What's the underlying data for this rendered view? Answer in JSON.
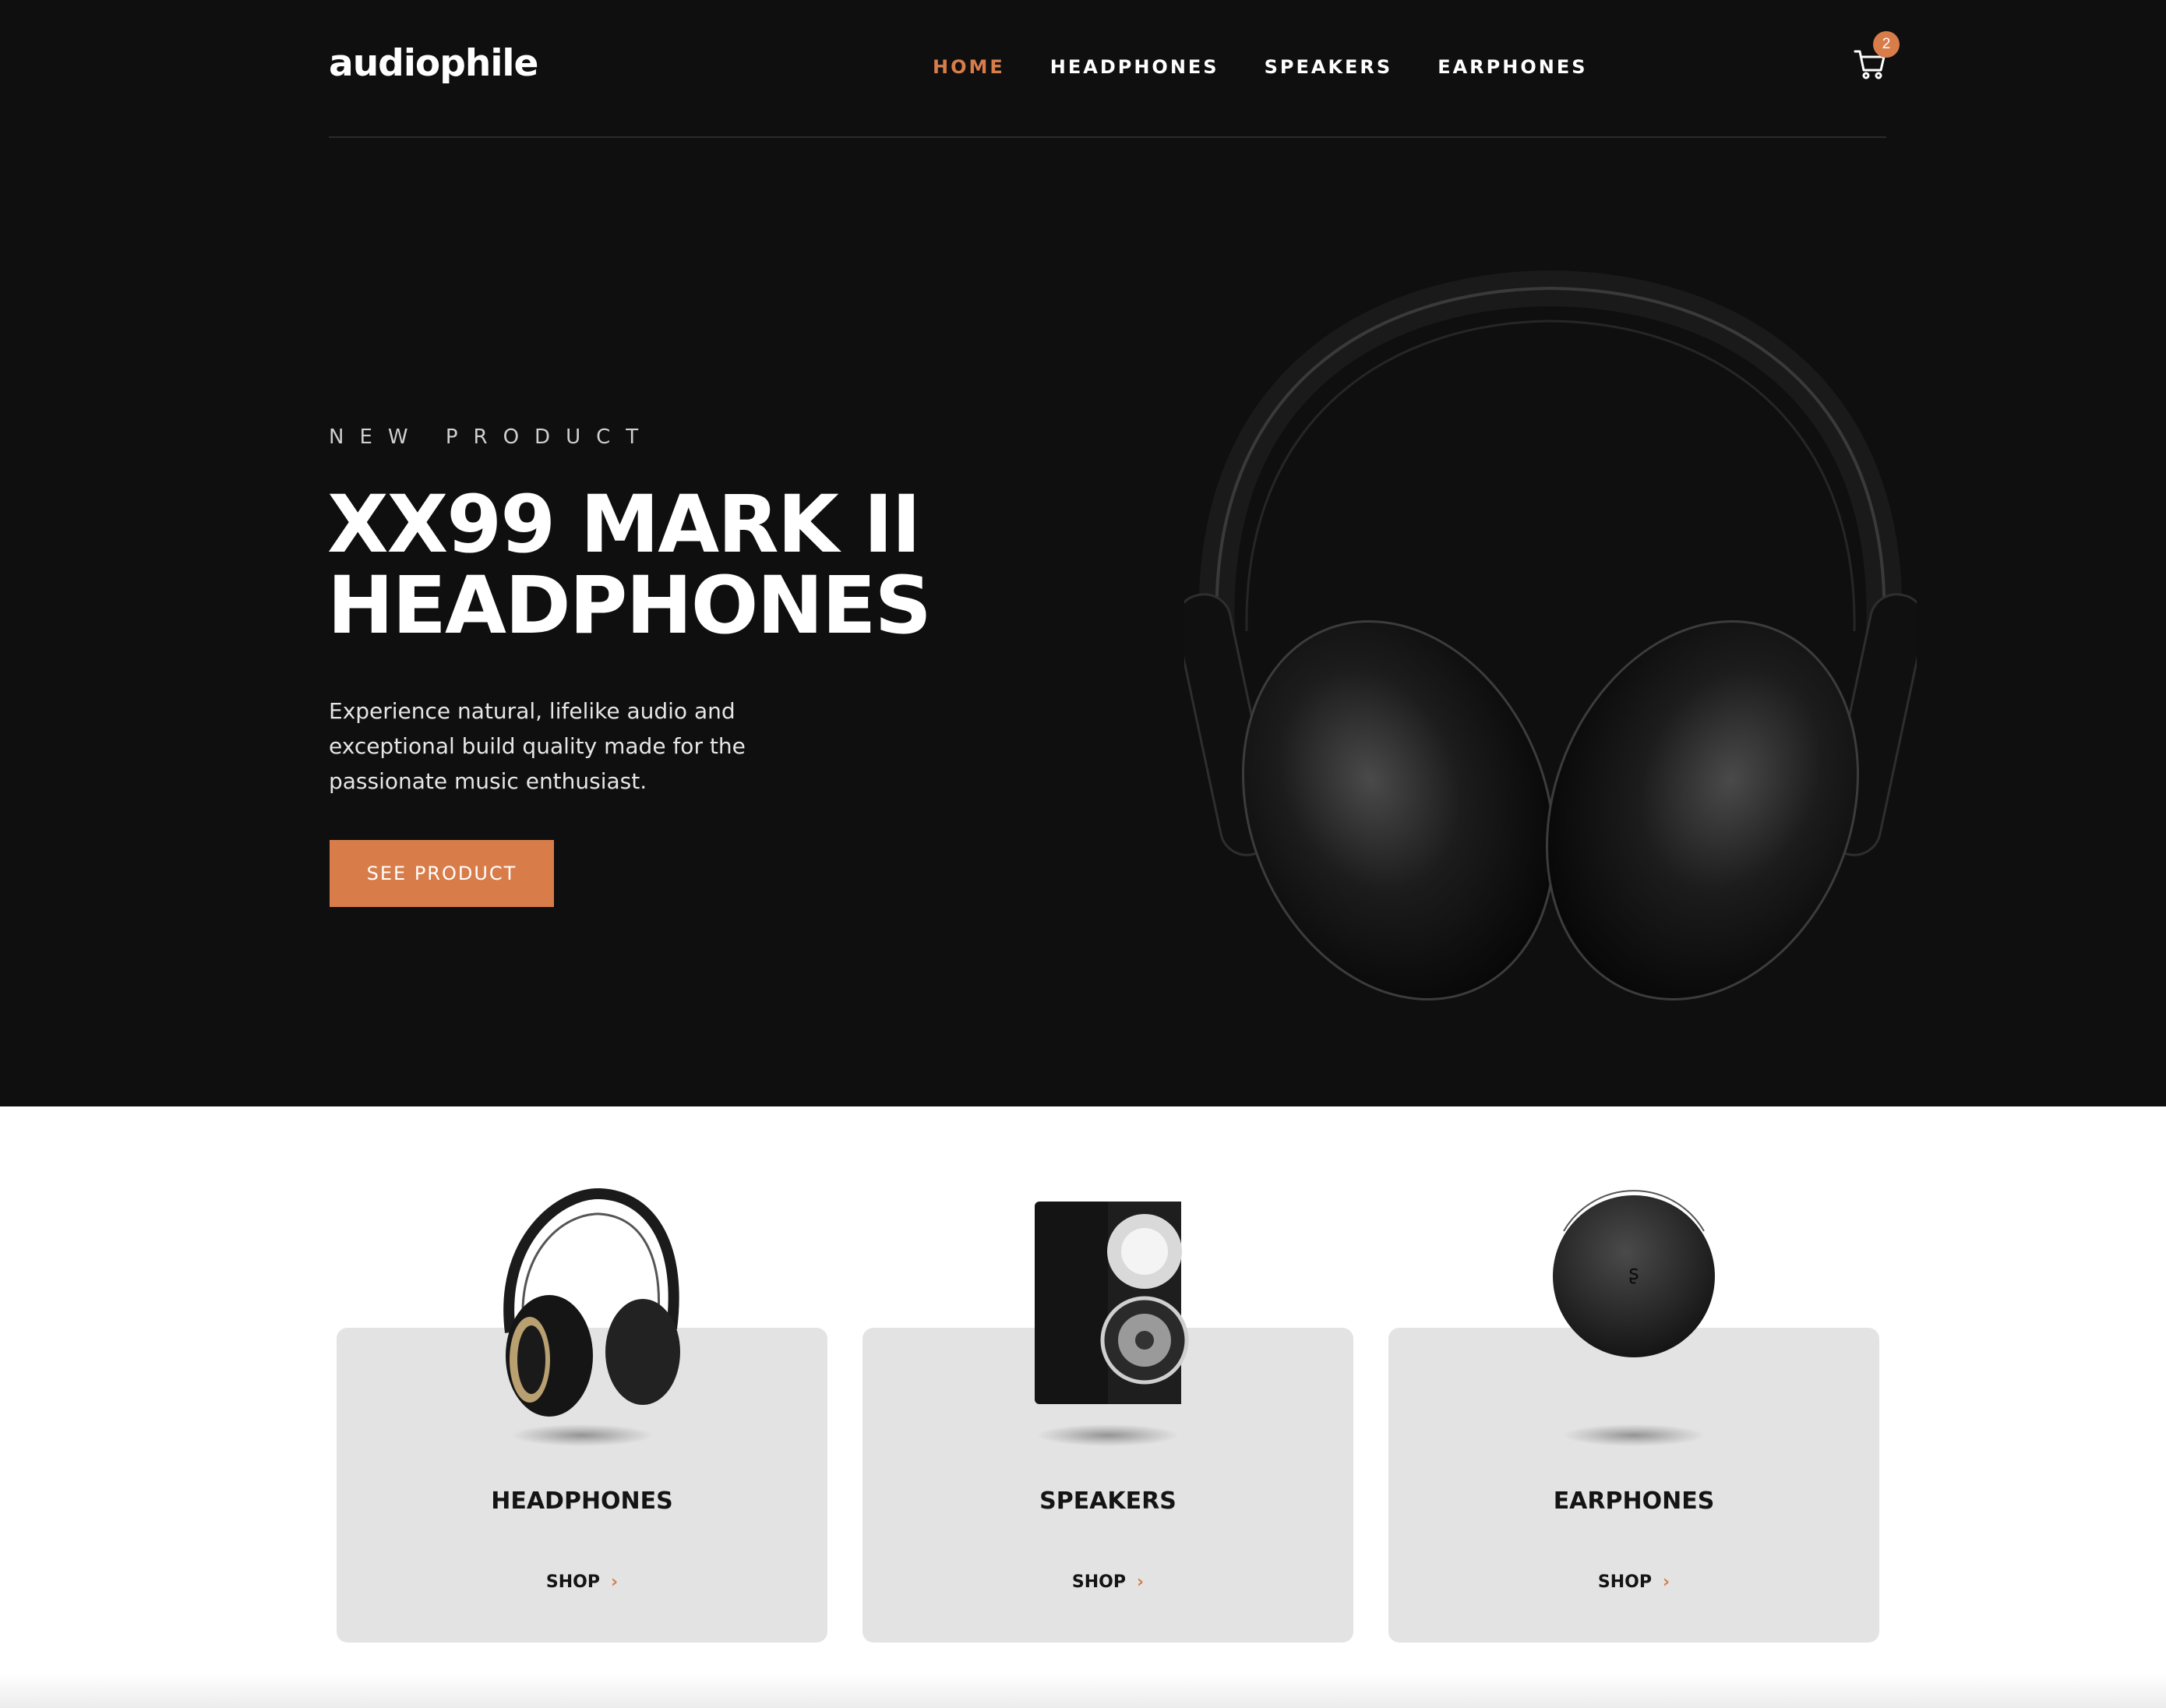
{
  "brand": {
    "logo_text": "audiophile"
  },
  "nav": {
    "links": [
      {
        "label": "HOME",
        "active": true
      },
      {
        "label": "HEADPHONES",
        "active": false
      },
      {
        "label": "SPEAKERS",
        "active": false
      },
      {
        "label": "EARPHONES",
        "active": false
      }
    ],
    "cart": {
      "icon": "cart-icon",
      "count": "2"
    }
  },
  "hero": {
    "overline": "NEW PRODUCT",
    "title_line1": "XX99 MARK II",
    "title_line2": "HEADPHONES",
    "description": "Experience natural, lifelike audio and exceptional build quality made for the passionate music enthusiast.",
    "cta_label": "SEE PRODUCT"
  },
  "categories": [
    {
      "title": "HEADPHONES",
      "shop_label": "SHOP",
      "icon": "headphones-icon"
    },
    {
      "title": "SPEAKERS",
      "shop_label": "SHOP",
      "icon": "speaker-icon"
    },
    {
      "title": "EARPHONES",
      "shop_label": "SHOP",
      "icon": "earphones-case-icon"
    }
  ],
  "colors": {
    "accent": "#d87d4a",
    "hero_bg": "#0f0f0f",
    "card_bg": "#e3e3e3",
    "text_dark": "#141414"
  }
}
